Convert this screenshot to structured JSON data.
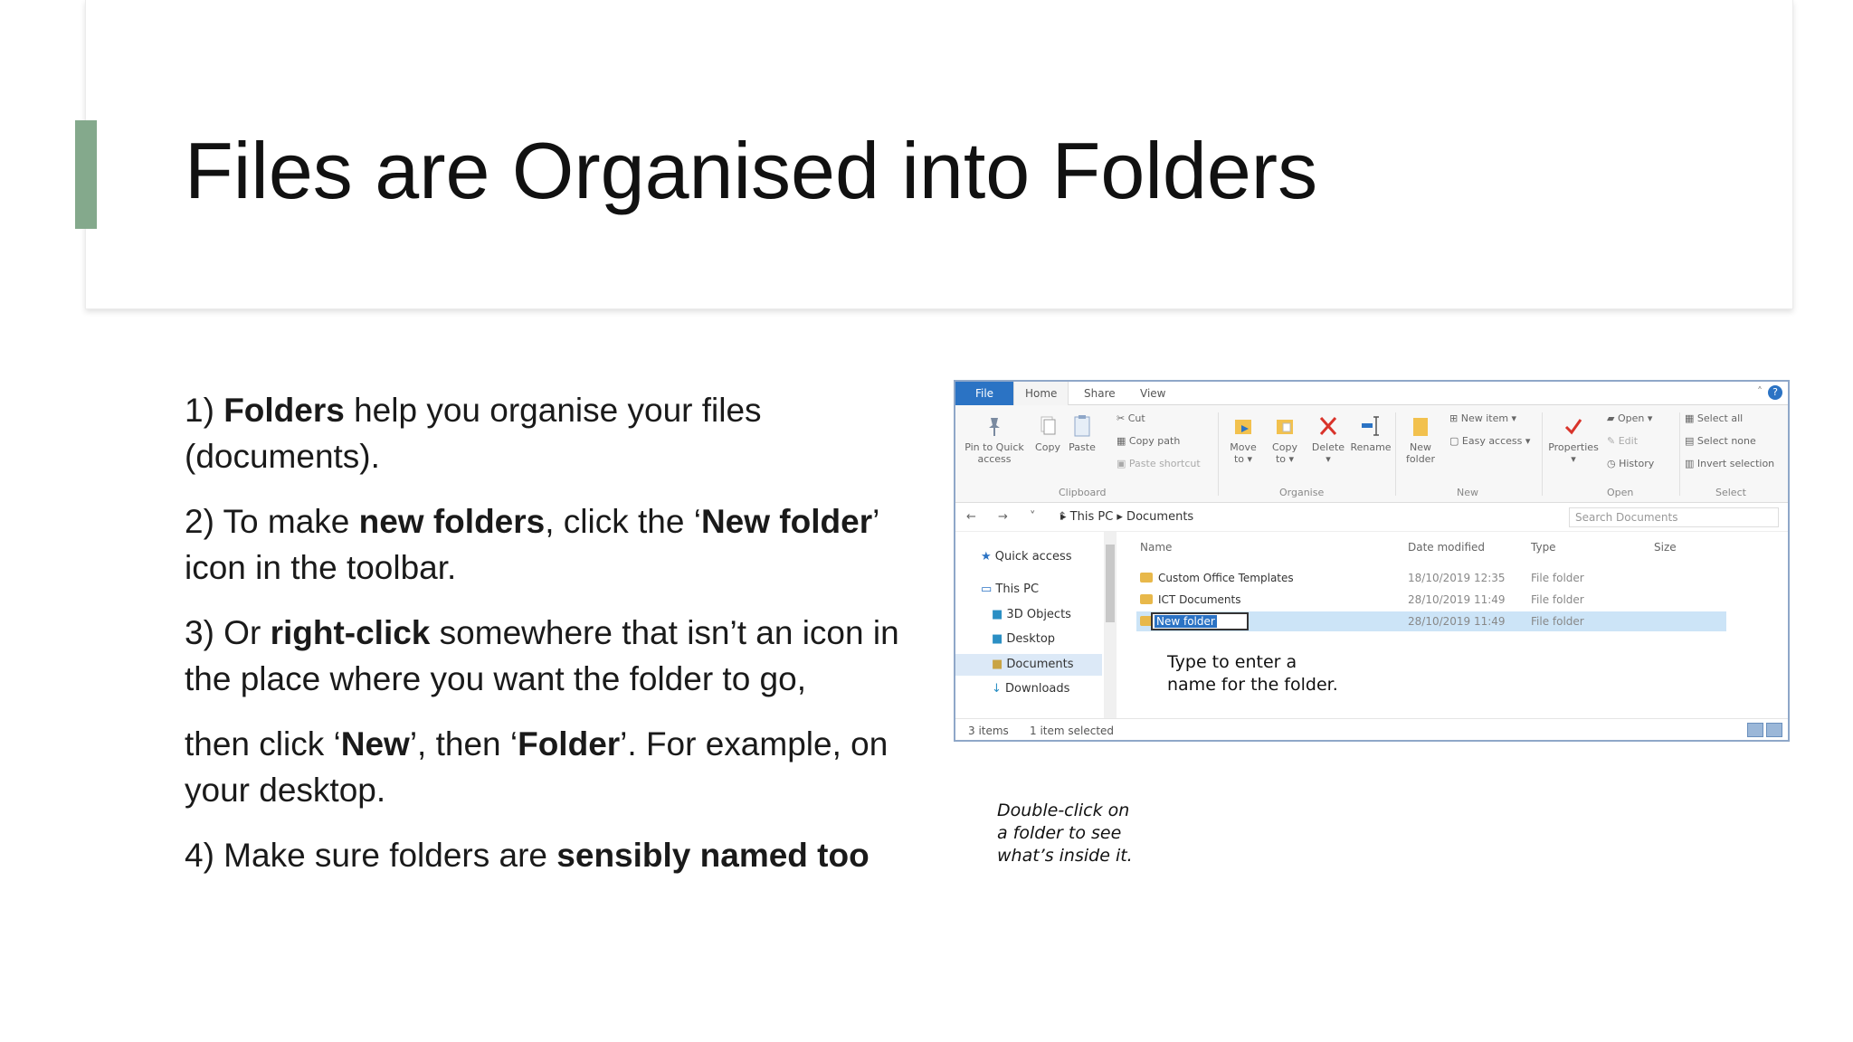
{
  "slide": {
    "title": "Files are Organised into Folders",
    "accent_color": "#84a98c",
    "points": [
      {
        "n": "1) ",
        "b1": "Folders",
        "t1": " help you organise your files (documents).",
        "b2": "",
        "t2": "",
        "b3": "",
        "t3": ""
      },
      {
        "n": "2) To make ",
        "b1": "new folders",
        "t1": ", click the ‘",
        "b2": "New folder",
        "t2": "’ icon in the toolbar.",
        "b3": "",
        "t3": ""
      },
      {
        "n": "3) Or ",
        "b1": "right-click",
        "t1": " somewhere that isn’t an icon in the place where you want the folder to go,",
        "b2": "",
        "t2": "",
        "b3": "",
        "t3": ""
      },
      {
        "n": "then click ‘",
        "b1": "New",
        "t1": "’, then ‘",
        "b2": "Folder",
        "t2": "’. For example, on your desktop.",
        "b3": "",
        "t3": ""
      },
      {
        "n": "4) Make sure folders are ",
        "b1": "sensibly named too",
        "t1": "",
        "b2": "",
        "t2": "",
        "b3": "",
        "t3": ""
      }
    ],
    "note_outside": [
      "Double-click on",
      "a folder to see",
      "what’s inside it."
    ]
  },
  "explorer": {
    "tabs": [
      "File",
      "Home",
      "Share",
      "View"
    ],
    "ribbon": {
      "pin": [
        "Pin to Quick",
        "access"
      ],
      "copy": "Copy",
      "paste": "Paste",
      "cut": "Cut",
      "copy_path": "Copy path",
      "paste_shortcut": "Paste shortcut",
      "move_to": [
        "Move",
        "to ▾"
      ],
      "copy_to": [
        "Copy",
        "to ▾"
      ],
      "delete": [
        "Delete",
        "▾"
      ],
      "rename": "Rename",
      "new_folder": [
        "New",
        "folder"
      ],
      "new_item": "New item ▾",
      "easy_access": "Easy access ▾",
      "properties": [
        "Properties",
        "▾"
      ],
      "open": "Open ▾",
      "edit": "Edit",
      "history": "History",
      "select_all": "Select all",
      "select_none": "Select none",
      "invert_selection": "Invert selection",
      "groups": [
        "Clipboard",
        "Organise",
        "New",
        "Open",
        "Select"
      ]
    },
    "address": {
      "arrows": "← → ˅ ↑",
      "path": "▸ This PC ▸ Documents",
      "search_placeholder": "Search Documents"
    },
    "nav": [
      "Quick access",
      "This PC",
      "3D Objects",
      "Desktop",
      "Documents",
      "Downloads"
    ],
    "columns": [
      "Name",
      "Date modified",
      "Type",
      "Size"
    ],
    "rows": [
      {
        "name": "Custom Office Templates",
        "date": "18/10/2019 12:35",
        "type": "File folder"
      },
      {
        "name": "ICT Documents",
        "date": "28/10/2019 11:49",
        "type": "File folder"
      },
      {
        "name": "New folder",
        "date": "28/10/2019 11:49",
        "type": "File folder"
      }
    ],
    "note_inside": [
      "Type to enter a",
      "name for the folder."
    ],
    "status": [
      "3 items",
      "1 item selected"
    ]
  }
}
